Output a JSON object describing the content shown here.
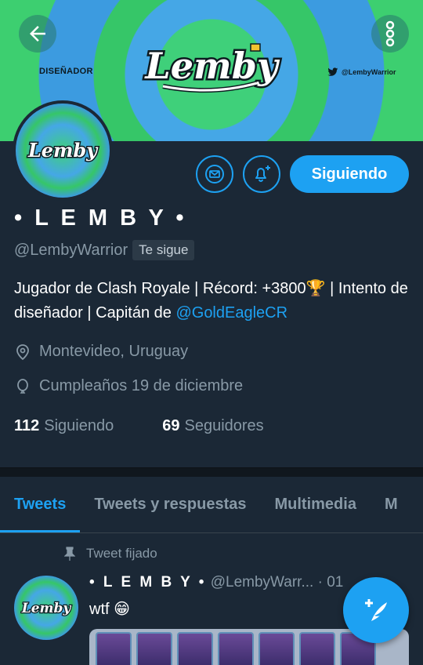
{
  "banner": {
    "logo_text": "Lemby",
    "left_text": "DISEÑADOR",
    "right_text": "@LembyWarrior"
  },
  "profile": {
    "avatar_logo_text": "Lemby",
    "display_name": "• L E M B Y •",
    "handle": "@LembyWarrior",
    "follows_you": "Te sigue",
    "follow_button": "Siguiendo",
    "bio_part1": "Jugador de Clash Royale | Récord: +3800",
    "bio_trophy": "🏆",
    "bio_part2": " | Intento de diseñador | Capitán de ",
    "bio_link": "@GoldEagleCR",
    "location": "Montevideo, Uruguay",
    "birthday": "Cumpleaños 19 de diciembre",
    "following_count": "112",
    "following_label": "Siguiendo",
    "followers_count": "69",
    "followers_label": "Seguidores"
  },
  "tabs": [
    {
      "label": "Tweets"
    },
    {
      "label": "Tweets y respuestas"
    },
    {
      "label": "Multimedia"
    },
    {
      "label": "M"
    }
  ],
  "tweet": {
    "pinned_label": "Tweet fijado",
    "avatar_logo_text": "Lemby",
    "name": "• L E M B Y •",
    "handle": "@LembyWarr...",
    "sep": " · ",
    "time": "01",
    "text": "wtf 😁"
  },
  "colors": {
    "accent": "#1da1f2",
    "background": "#1b2836",
    "muted": "#8899a6"
  }
}
